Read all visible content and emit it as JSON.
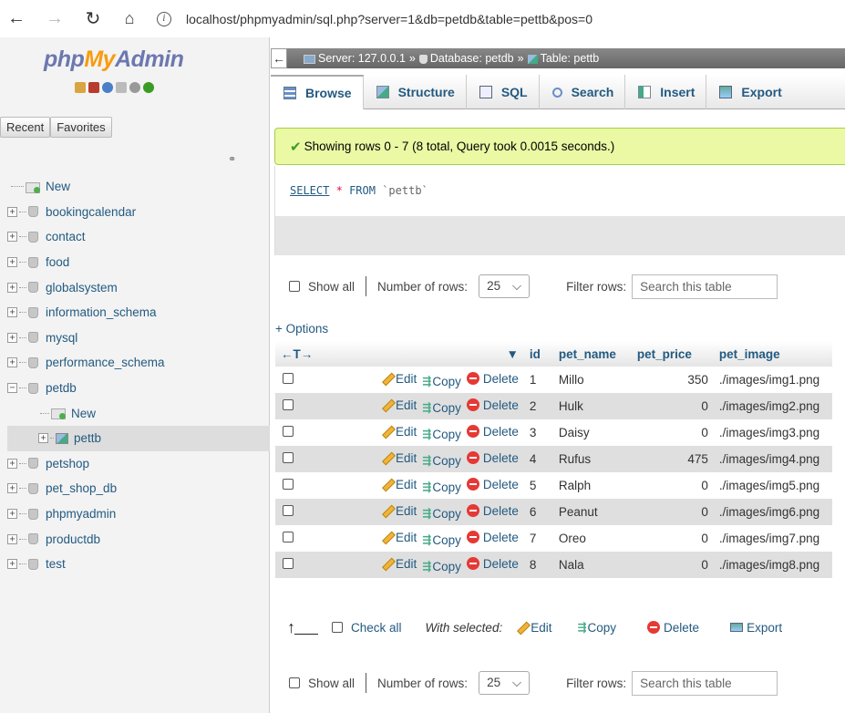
{
  "browser": {
    "url": "localhost/phpmyadmin/sql.php?server=1&db=petdb&table=pettb&pos=0"
  },
  "logo": {
    "php": "php",
    "my": "My",
    "admin": "Admin"
  },
  "nav_tabs": {
    "recent": "Recent",
    "favorites": "Favorites"
  },
  "tree": {
    "new_label": "New",
    "databases": [
      "bookingcalendar",
      "contact",
      "food",
      "globalsystem",
      "information_schema",
      "mysql",
      "performance_schema",
      "petdb"
    ],
    "petdb_children": {
      "new_label": "New",
      "table": "pettb"
    },
    "databases_after": [
      "petshop",
      "pet_shop_db",
      "phpmyadmin",
      "productdb",
      "test"
    ]
  },
  "breadcrumb": {
    "server": "Server: 127.0.0.1",
    "database": "Database: petdb",
    "table": "Table: pettb",
    "sep": "»"
  },
  "tabs": [
    {
      "label": "Browse"
    },
    {
      "label": "Structure"
    },
    {
      "label": "SQL"
    },
    {
      "label": "Search"
    },
    {
      "label": "Insert"
    },
    {
      "label": "Export"
    }
  ],
  "message": "Showing rows 0 - 7 (8 total, Query took 0.0015 seconds.)",
  "sql": {
    "select": "SELECT",
    "star": "*",
    "from": "FROM",
    "table": "`pettb`"
  },
  "nav_controls": {
    "show_all": "Show all",
    "number_of_rows": "Number of rows:",
    "rows_value": "25",
    "filter_rows": "Filter rows:",
    "search_placeholder": "Search this table"
  },
  "options_link": "+ Options",
  "table": {
    "columns": [
      "id",
      "pet_name",
      "pet_price",
      "pet_image"
    ],
    "actions": {
      "edit": "Edit",
      "copy": "Copy",
      "delete": "Delete"
    },
    "rows": [
      {
        "id": "1",
        "pet_name": "Millo",
        "pet_price": "350",
        "pet_image": "./images/img1.png"
      },
      {
        "id": "2",
        "pet_name": "Hulk",
        "pet_price": "0",
        "pet_image": "./images/img2.png"
      },
      {
        "id": "3",
        "pet_name": "Daisy",
        "pet_price": "0",
        "pet_image": "./images/img3.png"
      },
      {
        "id": "4",
        "pet_name": "Rufus",
        "pet_price": "475",
        "pet_image": "./images/img4.png"
      },
      {
        "id": "5",
        "pet_name": "Ralph",
        "pet_price": "0",
        "pet_image": "./images/img5.png"
      },
      {
        "id": "6",
        "pet_name": "Peanut",
        "pet_price": "0",
        "pet_image": "./images/img6.png"
      },
      {
        "id": "7",
        "pet_name": "Oreo",
        "pet_price": "0",
        "pet_image": "./images/img7.png"
      },
      {
        "id": "8",
        "pet_name": "Nala",
        "pet_price": "0",
        "pet_image": "./images/img8.png"
      }
    ]
  },
  "bulk": {
    "check_all": "Check all",
    "with_selected": "With selected:",
    "edit": "Edit",
    "copy": "Copy",
    "delete": "Delete",
    "export": "Export"
  },
  "colors": {
    "link": "#235a81",
    "success_bg": "#ebf8a4",
    "row_alt": "#dfdfdf"
  }
}
